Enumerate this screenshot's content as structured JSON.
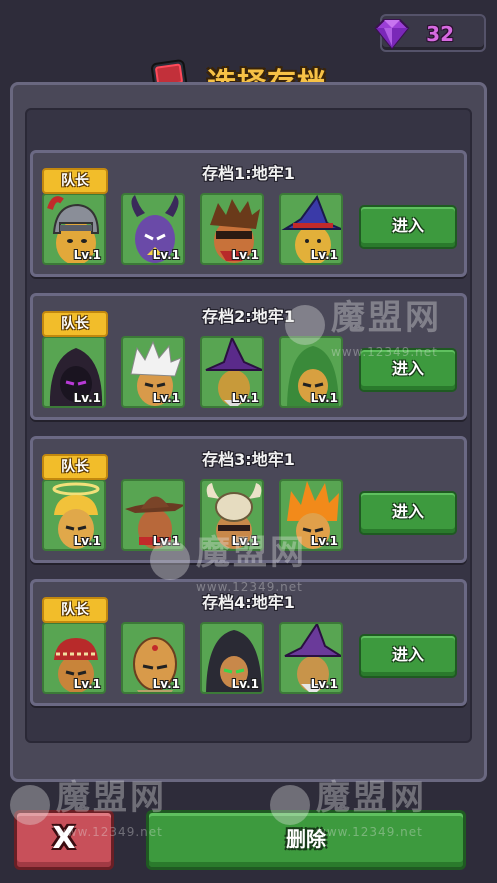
{
  "currency": {
    "gem_count": "32",
    "gem_icon": "purple-gem-icon",
    "gem_color": "#9b3fd6"
  },
  "header": {
    "title": "选择存档",
    "icon": "save-card-icon"
  },
  "slots": [
    {
      "title": "存档1:地牢1",
      "leader_label": "队长",
      "enter_label": "进入",
      "heroes": [
        {
          "name": "knight-hero",
          "level": "Lv.1"
        },
        {
          "name": "horned-demon-hero",
          "level": "Lv.1"
        },
        {
          "name": "masked-warrior-hero",
          "level": "Lv.1"
        },
        {
          "name": "wizard-hero",
          "level": "Lv.1"
        }
      ]
    },
    {
      "title": "存档2:地牢1",
      "leader_label": "队长",
      "enter_label": "进入",
      "heroes": [
        {
          "name": "hooded-shadow-hero",
          "level": "Lv.1"
        },
        {
          "name": "white-hair-hero",
          "level": "Lv.1"
        },
        {
          "name": "purple-witch-hero",
          "level": "Lv.1"
        },
        {
          "name": "green-hood-hero",
          "level": "Lv.1"
        }
      ]
    },
    {
      "title": "存档3:地牢1",
      "leader_label": "队长",
      "enter_label": "进入",
      "heroes": [
        {
          "name": "halo-hero",
          "level": "Lv.1"
        },
        {
          "name": "cowboy-hero",
          "level": "Lv.1"
        },
        {
          "name": "skull-helm-hero",
          "level": "Lv.1"
        },
        {
          "name": "flame-hair-hero",
          "level": "Lv.1"
        }
      ]
    },
    {
      "title": "存档4:地牢1",
      "leader_label": "队长",
      "enter_label": "进入",
      "heroes": [
        {
          "name": "bandana-hero",
          "level": "Lv.1"
        },
        {
          "name": "monk-hero",
          "level": "Lv.1"
        },
        {
          "name": "dark-hood-hero",
          "level": "Lv.1"
        },
        {
          "name": "purple-mage-hero",
          "level": "Lv.1"
        }
      ]
    }
  ],
  "footer": {
    "close_label": "X",
    "delete_label": "删除"
  },
  "watermark": {
    "brand": "魔盟网",
    "url": "www.12349.net"
  }
}
